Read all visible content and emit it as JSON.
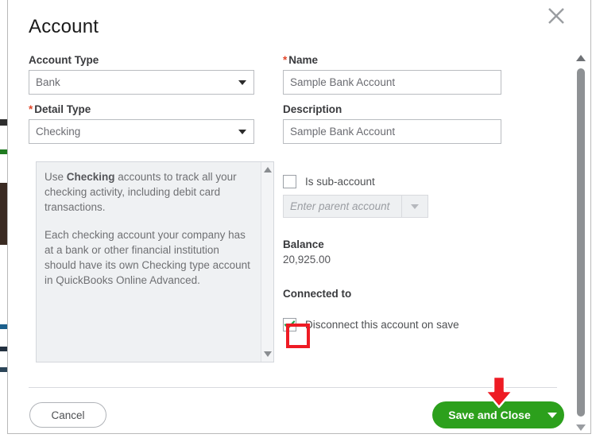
{
  "dialog": {
    "title": "Account",
    "close_icon": "close-icon"
  },
  "form": {
    "account_type": {
      "label": "Account Type",
      "required": false,
      "value": "Bank"
    },
    "detail_type": {
      "label": "Detail Type",
      "required": true,
      "required_marker": "*",
      "value": "Checking"
    },
    "name": {
      "label": "Name",
      "required": true,
      "required_marker": "*",
      "value": "Sample Bank Account"
    },
    "description": {
      "label": "Description",
      "required": false,
      "value": "Sample Bank Account"
    },
    "is_sub_account": {
      "label": "Is sub-account",
      "checked": false
    },
    "parent_account": {
      "placeholder": "Enter parent account",
      "value": "",
      "disabled": true
    },
    "balance": {
      "label": "Balance",
      "value": "20,925.00"
    },
    "connected_to": {
      "label": "Connected to"
    },
    "disconnect": {
      "label": "Disconnect this account on save",
      "checked": true
    }
  },
  "info_panel": {
    "paragraph_1_pre": "Use ",
    "paragraph_1_bold": "Checking",
    "paragraph_1_post": " accounts to track all your checking activity, including debit card transactions.",
    "paragraph_2": "Each checking account your company has at a bank or other financial institution should have its own Checking type account in QuickBooks Online Advanced."
  },
  "footer": {
    "cancel_label": "Cancel",
    "save_label": "Save and Close",
    "save_caret_icon": "chevron-down-icon"
  },
  "annotations": {
    "highlight_color": "#ee1b24",
    "arrow_color": "#ee1b24",
    "arrow_icon": "down-arrow-annotation"
  },
  "colors": {
    "brand_green": "#2ca01c",
    "required_red": "#e2472a",
    "checkmark_green": "#24a148",
    "info_bg": "#eff1f3"
  },
  "scrollbars": {
    "main_up_icon": "scroll-up-arrow",
    "main_down_icon": "scroll-down-arrow",
    "info_up_icon": "scroll-up-arrow",
    "info_down_icon": "scroll-down-arrow"
  }
}
